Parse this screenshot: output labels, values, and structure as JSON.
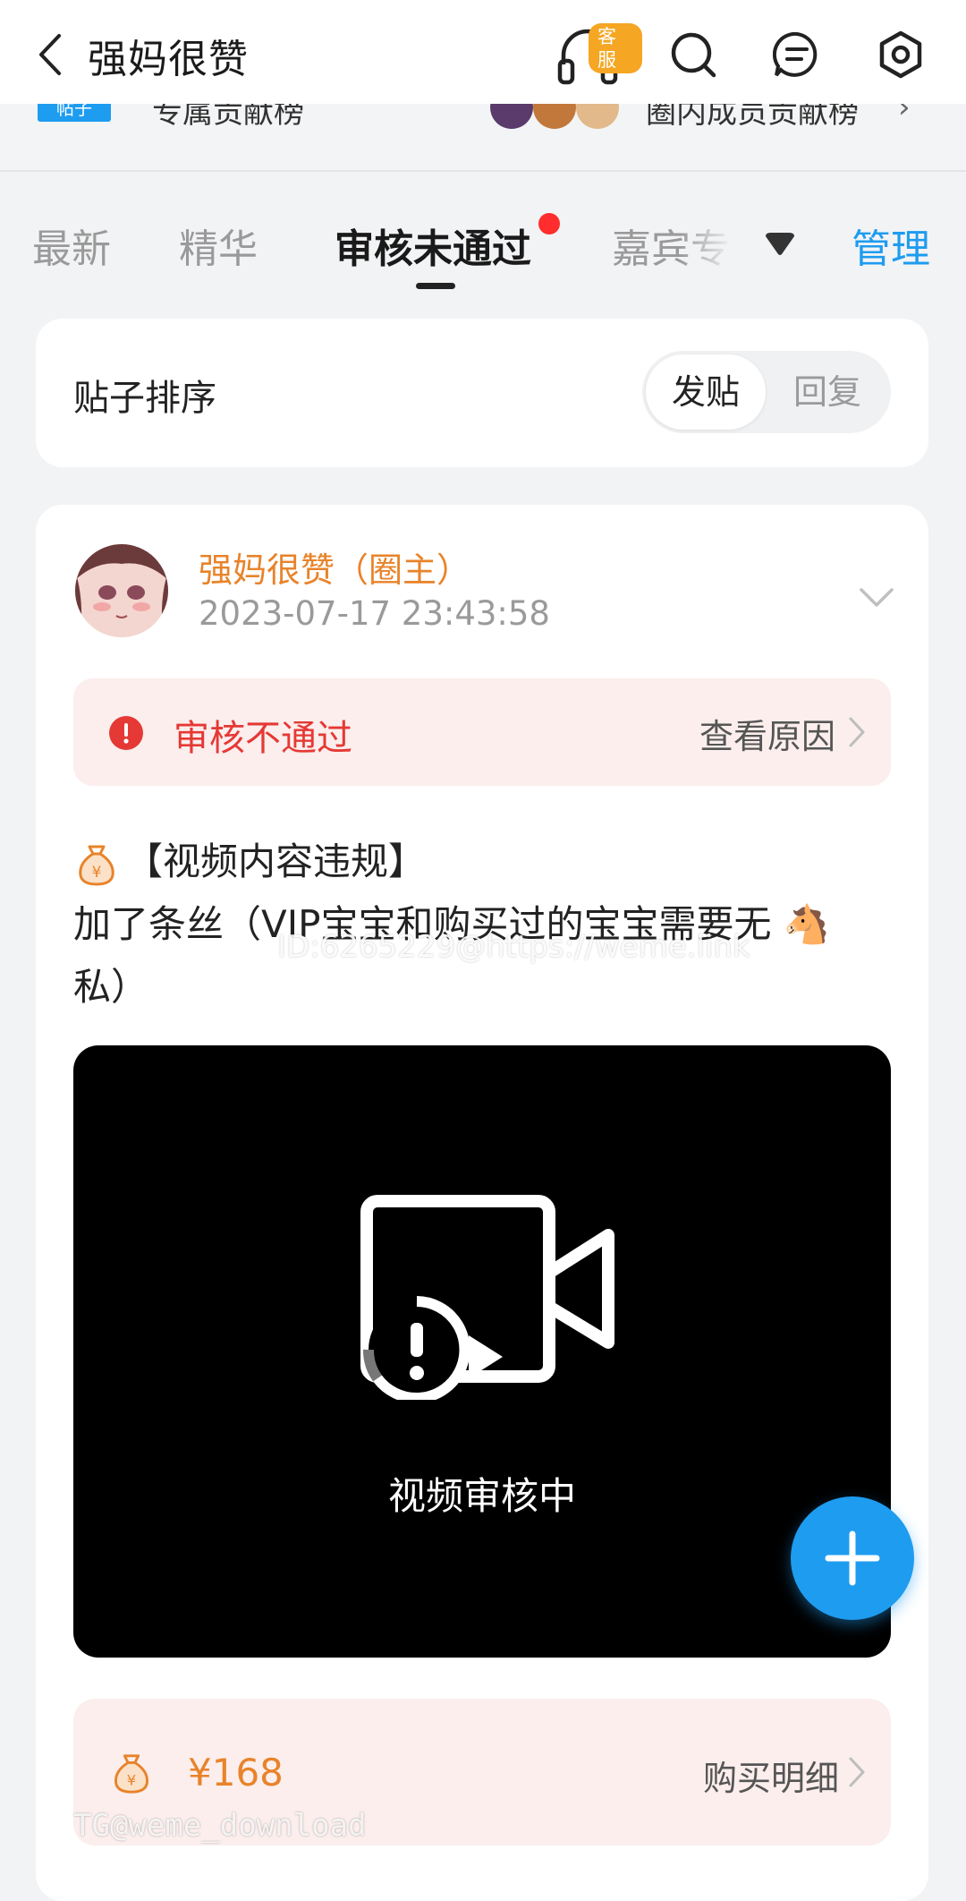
{
  "header": {
    "title": "强妈很赞",
    "customer_service_badge": "客服",
    "icons": [
      "back-icon",
      "headset-icon",
      "search-icon",
      "message-icon",
      "settings-icon"
    ]
  },
  "contribution_strip": {
    "badge": "帖子",
    "left_label": "专属贡献榜",
    "right_label": "圈内成员贡献榜",
    "chevron": "›"
  },
  "tabs": {
    "items": [
      "最新",
      "精华",
      "审核未通过",
      "嘉宾专"
    ],
    "active_index": 2,
    "manage_label": "管理"
  },
  "sort": {
    "label": "贴子排序",
    "options": [
      "发贴",
      "回复"
    ],
    "selected": "发贴"
  },
  "post": {
    "author": "强妈很赞（圈主）",
    "timestamp": "2023-07-17 23:43:58",
    "status_text": "审核不通过",
    "status_link": "查看原因",
    "title_line": "【视频内容违规】",
    "body_line": "加了条丝（VIP宝宝和购买过的宝宝需要无 🐴 私）",
    "video_status": "视频审核中",
    "price": "¥168",
    "price_link": "购买明细"
  },
  "overlay": {
    "watermark": "ID:6265229@https://weme.link",
    "footer_watermark": "TG@weme_download"
  },
  "colors": {
    "accent": "#1e9cf0",
    "author_orange": "#e8832a",
    "error_red": "#e53935",
    "tab_dot": "#ff2d2d",
    "card_bg": "#ffffff",
    "page_bg": "#f2f3f5"
  }
}
